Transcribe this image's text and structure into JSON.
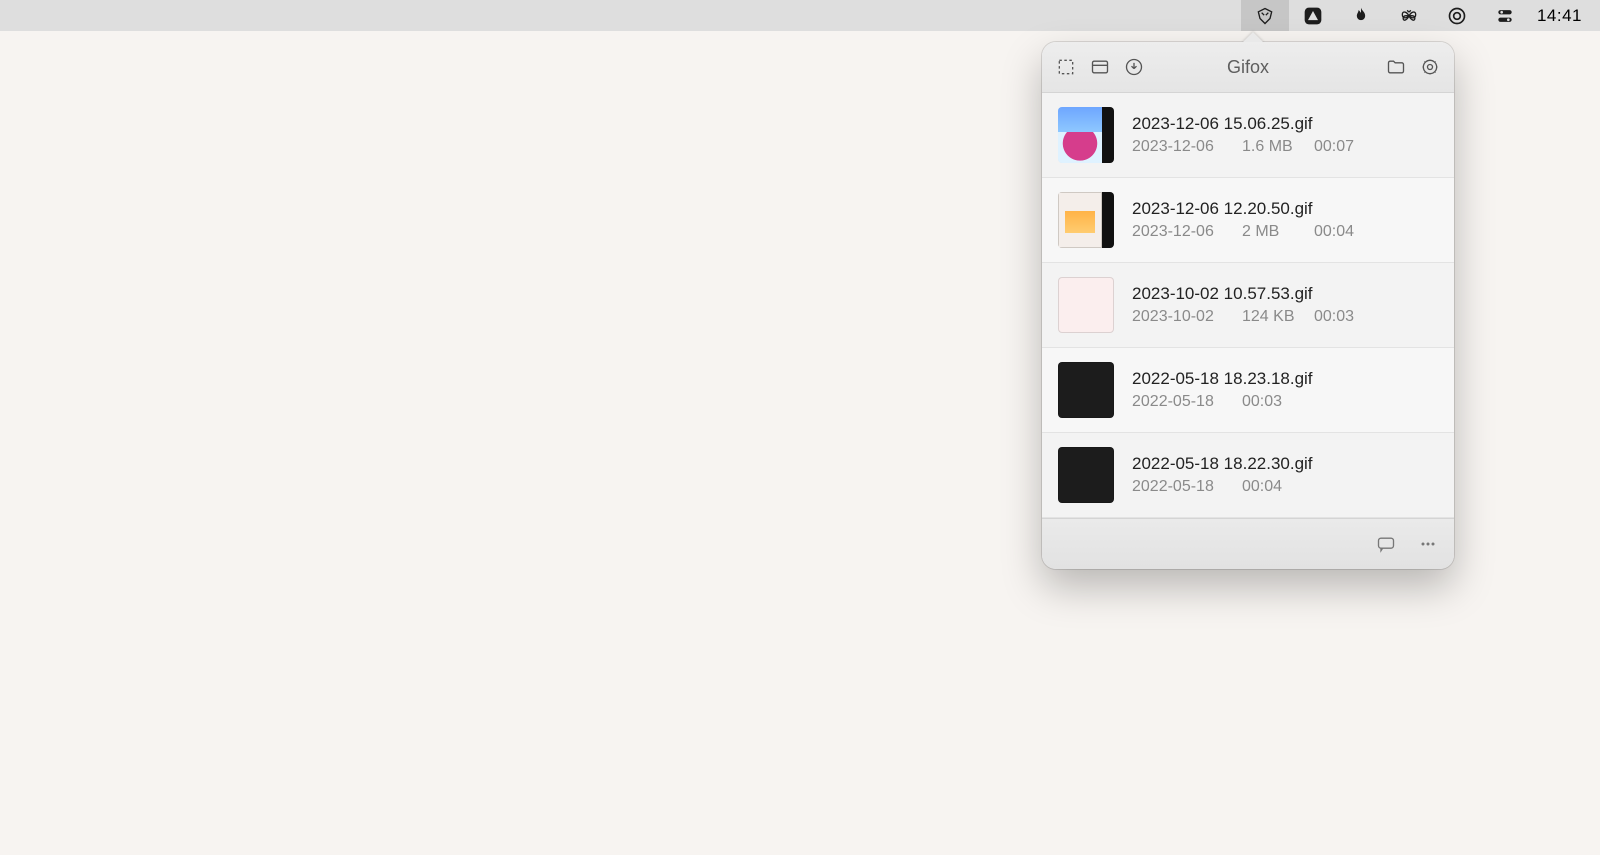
{
  "menubar": {
    "clock": "14:41"
  },
  "popover": {
    "title": "Gifox",
    "files": [
      {
        "name": "2023-12-06 15.06.25.gif",
        "date": "2023-12-06",
        "size": "1.6 MB",
        "duration": "00:07",
        "thumb": "t1",
        "rb": true
      },
      {
        "name": "2023-12-06 12.20.50.gif",
        "date": "2023-12-06",
        "size": "2 MB",
        "duration": "00:04",
        "thumb": "t2",
        "rb": true
      },
      {
        "name": "2023-10-02 10.57.53.gif",
        "date": "2023-10-02",
        "size": "124 KB",
        "duration": "00:03",
        "thumb": "t3",
        "rb": false
      },
      {
        "name": "2022-05-18 18.23.18.gif",
        "date": "2022-05-18",
        "size": "",
        "duration": "00:03",
        "thumb": "t4",
        "rb": false
      },
      {
        "name": "2022-05-18 18.22.30.gif",
        "date": "2022-05-18",
        "size": "",
        "duration": "00:04",
        "thumb": "t5",
        "rb": false
      }
    ]
  }
}
